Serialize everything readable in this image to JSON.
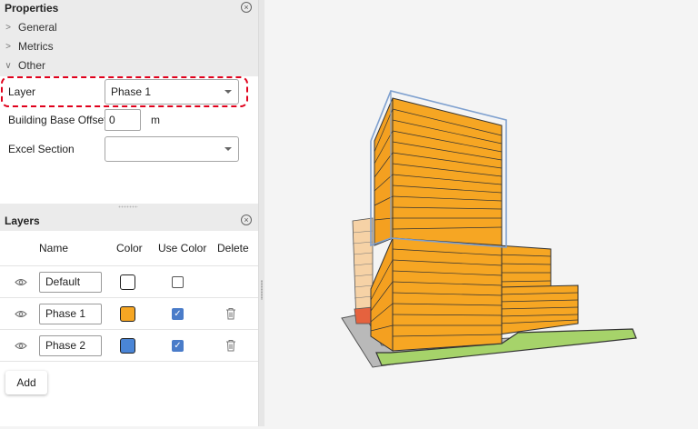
{
  "properties": {
    "title": "Properties",
    "sections": [
      {
        "label": "General",
        "expanded": false
      },
      {
        "label": "Metrics",
        "expanded": false
      },
      {
        "label": "Other",
        "expanded": true
      }
    ],
    "fields": {
      "layer": {
        "label": "Layer",
        "value": "Phase 1"
      },
      "base_offset": {
        "label": "Building Base Offset",
        "value": "0",
        "unit": "m"
      },
      "excel_section": {
        "label": "Excel Section",
        "value": ""
      }
    }
  },
  "layers": {
    "title": "Layers",
    "columns": {
      "name": "Name",
      "color": "Color",
      "use_color": "Use Color",
      "delete": "Delete"
    },
    "rows": [
      {
        "name": "Default",
        "color": "#ffffff",
        "use_color": false,
        "deletable": false
      },
      {
        "name": "Phase 1",
        "color": "#f6a623",
        "use_color": true,
        "deletable": true
      },
      {
        "name": "Phase 2",
        "color": "#4a85d6",
        "use_color": true,
        "deletable": true
      }
    ],
    "add_label": "Add"
  },
  "icons": {
    "close": "close-icon",
    "visibility": "eye-icon",
    "delete": "trash-icon",
    "expand": "chevron-icon"
  },
  "colors": {
    "building_orange": "#f6a623",
    "site_green": "#a6d36a",
    "highlight_red": "#e0001b",
    "outline_blue": "#7ea0cf"
  }
}
